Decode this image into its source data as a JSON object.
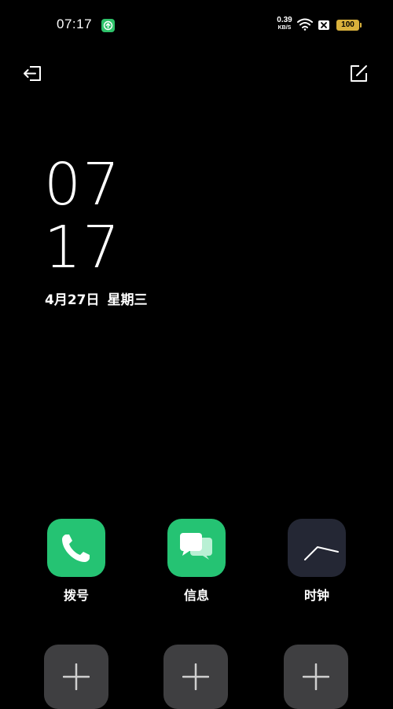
{
  "status_bar": {
    "time": "07:17",
    "net_speed_value": "0.39",
    "net_speed_unit": "KB/S",
    "battery": "100",
    "icons": [
      "upload-app-icon",
      "wifi-icon",
      "sim-x-icon",
      "battery-icon"
    ],
    "battery_color": "#d9b13c"
  },
  "toolbar": {
    "exit_icon": "exit-icon",
    "edit_icon": "edit-icon"
  },
  "clock": {
    "hours": "07",
    "minutes": "17",
    "date": "4月27日",
    "weekday": "星期三"
  },
  "apps": [
    {
      "label": "拨号",
      "icon": "phone-icon",
      "color": "#25c373"
    },
    {
      "label": "信息",
      "icon": "messages-icon",
      "color": "#25c373"
    },
    {
      "label": "时钟",
      "icon": "clock-icon",
      "color": "#242734"
    }
  ],
  "add_slots": [
    {
      "icon": "plus-icon"
    },
    {
      "icon": "plus-icon"
    },
    {
      "icon": "plus-icon"
    }
  ]
}
